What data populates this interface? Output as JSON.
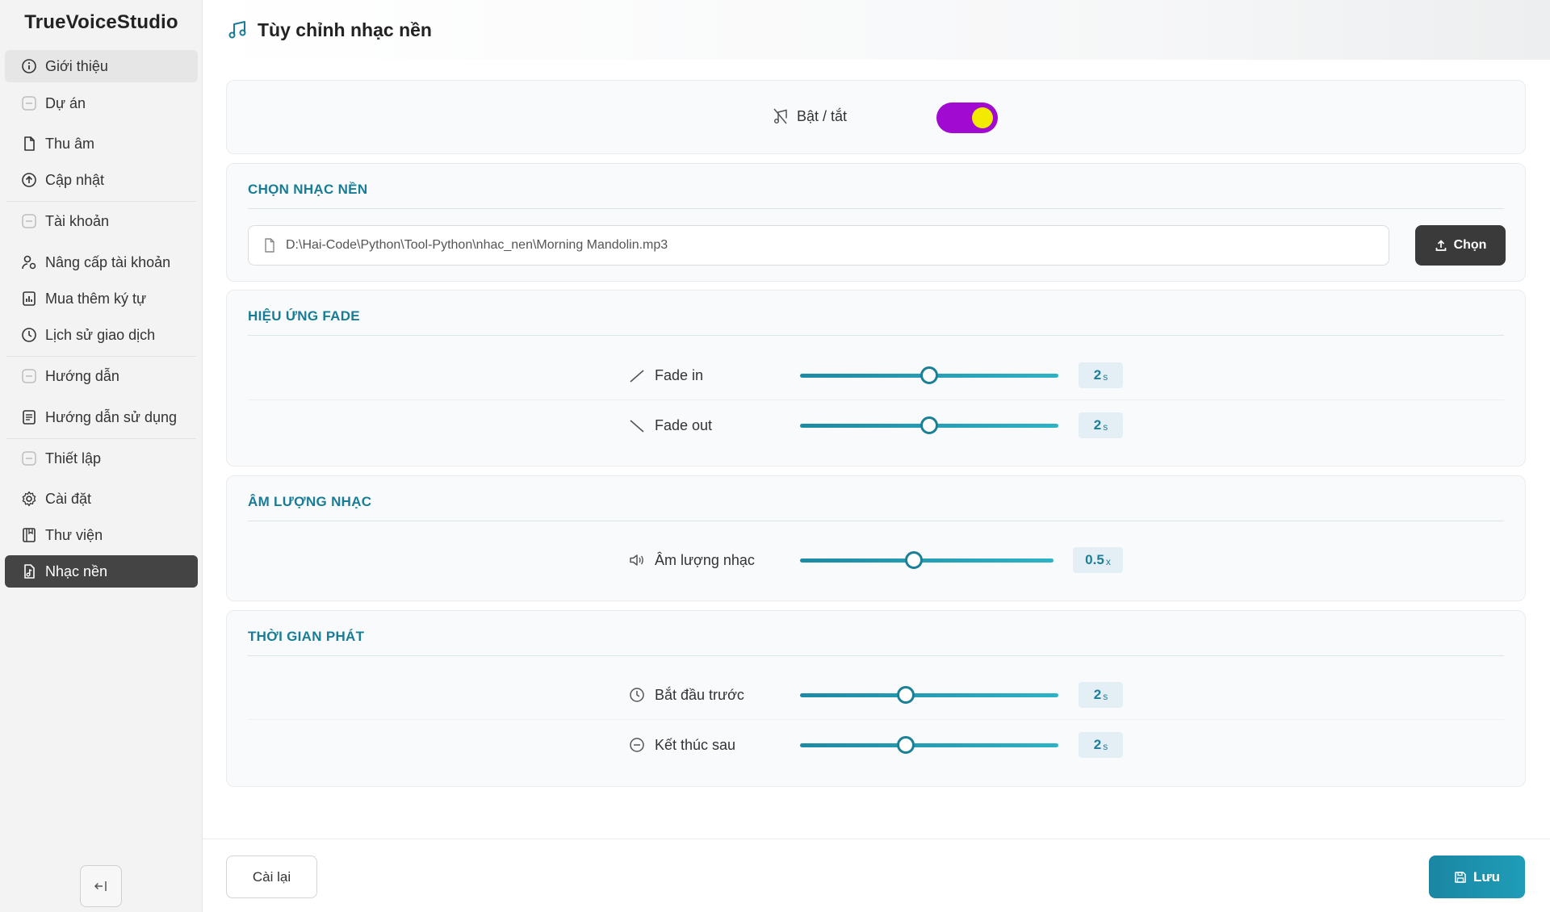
{
  "app": {
    "name": "TrueVoiceStudio"
  },
  "sidebar": {
    "items": [
      {
        "label": "Giới thiệu",
        "icon": "info-circle-icon"
      },
      {
        "label": "Dự án",
        "icon": "minus-square-icon"
      },
      {
        "label": "Thu âm",
        "icon": "file-icon"
      },
      {
        "label": "Cập nhật",
        "icon": "arrow-up-circle-icon"
      },
      {
        "label": "Tài khoản",
        "icon": "minus-square-icon"
      },
      {
        "label": "Nâng cấp tài khoản",
        "icon": "user-upgrade-icon"
      },
      {
        "label": "Mua thêm ký tự",
        "icon": "chart-bar-icon"
      },
      {
        "label": "Lịch sử giao dịch",
        "icon": "clock-history-icon"
      },
      {
        "label": "Hướng dẫn",
        "icon": "minus-square-icon"
      },
      {
        "label": "Hướng dẫn sử dụng",
        "icon": "document-list-icon"
      },
      {
        "label": "Thiết lập",
        "icon": "minus-square-icon"
      },
      {
        "label": "Cài đặt",
        "icon": "gear-icon"
      },
      {
        "label": "Thư viện",
        "icon": "book-icon"
      },
      {
        "label": "Nhạc nền",
        "icon": "music-file-icon"
      }
    ],
    "active": "Nhạc nền"
  },
  "header": {
    "title": "Tùy chỉnh nhạc nền",
    "icon": "music-note-icon"
  },
  "toggle": {
    "label": "Bật / tắt",
    "on": true,
    "track_color": "#a10bd1",
    "knob_color": "#f2ea00"
  },
  "music_select": {
    "title": "CHỌN NHẠC NỀN",
    "file_path": "D:\\Hai-Code\\Python\\Tool-Python\\nhac_nen\\Morning Mandolin.mp3",
    "choose_label": "Chọn"
  },
  "fade": {
    "title": "HIỆU ỨNG FADE",
    "fade_in": {
      "label": "Fade in",
      "value": "2",
      "unit": "s",
      "fraction": 0.5
    },
    "fade_out": {
      "label": "Fade out",
      "value": "2",
      "unit": "s",
      "fraction": 0.5
    }
  },
  "volume": {
    "title": "ÂM LƯỢNG NHẠC",
    "music_volume": {
      "label": "Âm lượng nhạc",
      "value": "0.5",
      "unit": "x",
      "fraction": 0.45
    }
  },
  "timing": {
    "title": "THỜI GIAN PHÁT",
    "start_before": {
      "label": "Bắt đầu trước",
      "value": "2",
      "unit": "s",
      "fraction": 0.41
    },
    "end_after": {
      "label": "Kết thúc sau",
      "value": "2",
      "unit": "s",
      "fraction": 0.41
    }
  },
  "footer": {
    "reset_label": "Cài lại",
    "save_label": "Lưu"
  },
  "colors": {
    "accent": "#197c97",
    "active_nav": "#444444",
    "save_button": "#1a86a3"
  }
}
